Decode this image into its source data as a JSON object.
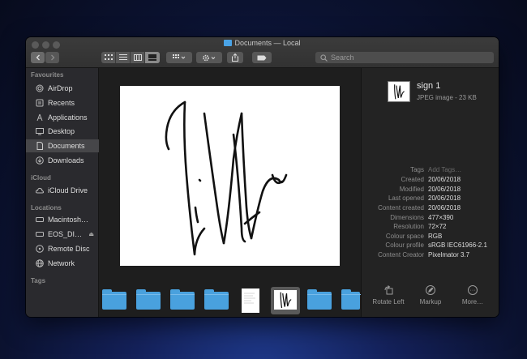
{
  "window": {
    "title": "Documents — Local",
    "search_placeholder": "Search"
  },
  "sidebar": {
    "sections": [
      {
        "heading": "Favourites",
        "items": [
          {
            "label": "AirDrop",
            "icon": "airdrop-icon"
          },
          {
            "label": "Recents",
            "icon": "recents-icon"
          },
          {
            "label": "Applications",
            "icon": "applications-icon"
          },
          {
            "label": "Desktop",
            "icon": "desktop-icon"
          },
          {
            "label": "Documents",
            "icon": "documents-icon",
            "selected": true
          },
          {
            "label": "Downloads",
            "icon": "downloads-icon"
          }
        ]
      },
      {
        "heading": "iCloud",
        "items": [
          {
            "label": "iCloud Drive",
            "icon": "cloud-icon"
          }
        ]
      },
      {
        "heading": "Locations",
        "items": [
          {
            "label": "Macintosh…",
            "icon": "disk-icon"
          },
          {
            "label": "EOS_DI…",
            "icon": "disk-icon",
            "eject": true
          },
          {
            "label": "Remote Disc",
            "icon": "remote-disc-icon"
          },
          {
            "label": "Network",
            "icon": "network-icon"
          }
        ]
      },
      {
        "heading": "Tags",
        "items": []
      }
    ]
  },
  "info": {
    "name": "sign 1",
    "kind": "JPEG image - 23 KB",
    "rows": [
      {
        "key": "Tags",
        "value": "Add Tags…",
        "placeholder": true
      },
      {
        "key": "Created",
        "value": "20/06/2018"
      },
      {
        "key": "Modified",
        "value": "20/06/2018"
      },
      {
        "key": "Last opened",
        "value": "20/06/2018"
      },
      {
        "key": "Content created",
        "value": "20/06/2018"
      },
      {
        "key": "Dimensions",
        "value": "477×390"
      },
      {
        "key": "Resolution",
        "value": "72×72"
      },
      {
        "key": "Colour space",
        "value": "RGB"
      },
      {
        "key": "Colour profile",
        "value": "sRGB IEC61966-2.1"
      },
      {
        "key": "Content Creator",
        "value": "Pixelmator 3.7"
      }
    ],
    "actions": [
      {
        "label": "Rotate Left",
        "icon": "rotate-left-icon"
      },
      {
        "label": "Markup",
        "icon": "markup-icon"
      },
      {
        "label": "More…",
        "icon": "more-icon"
      }
    ]
  },
  "colors": {
    "accent_folder": "#49a1de",
    "sidebar_bg": "#2a2a2e",
    "selected_row": "#464649"
  }
}
